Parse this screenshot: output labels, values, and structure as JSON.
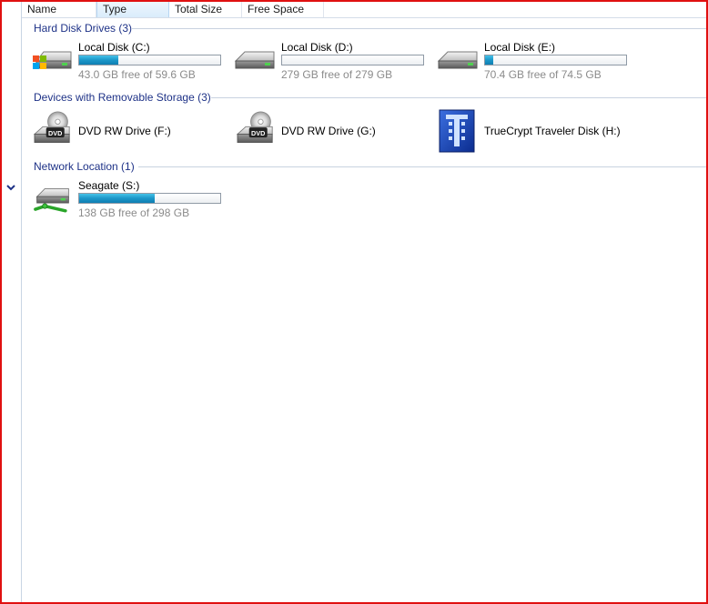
{
  "columns": [
    {
      "label": "Name"
    },
    {
      "label": "Type"
    },
    {
      "label": "Total Size"
    },
    {
      "label": "Free Space"
    }
  ],
  "groups": {
    "hard_disks": {
      "title": "Hard Disk Drives (3)",
      "items": [
        {
          "name": "Local Disk (C:)",
          "free_text": "43.0 GB free of 59.6 GB",
          "used_fraction": 0.28,
          "icon": "windows-hard-drive-icon"
        },
        {
          "name": "Local Disk (D:)",
          "free_text": "279 GB free of 279 GB",
          "used_fraction": 0.0,
          "icon": "hard-drive-icon"
        },
        {
          "name": "Local Disk (E:)",
          "free_text": "70.4 GB free of 74.5 GB",
          "used_fraction": 0.055,
          "icon": "hard-drive-icon"
        }
      ]
    },
    "removable": {
      "title": "Devices with Removable Storage (3)",
      "items": [
        {
          "name": "DVD RW Drive (F:)",
          "icon": "dvd-drive-icon",
          "badge": "DVD"
        },
        {
          "name": "DVD RW Drive (G:)",
          "icon": "dvd-drive-icon",
          "badge": "DVD"
        },
        {
          "name": "TrueCrypt Traveler Disk (H:)",
          "icon": "truecrypt-icon"
        }
      ]
    },
    "network": {
      "title": "Network Location (1)",
      "items": [
        {
          "name": "Seagate (S:)",
          "free_text": "138 GB free of 298 GB",
          "used_fraction": 0.537,
          "icon": "network-drive-icon"
        }
      ]
    }
  },
  "colors": {
    "accent_bar": "#1c97c8",
    "group_title": "#1e3287",
    "frame": "#e01010"
  }
}
